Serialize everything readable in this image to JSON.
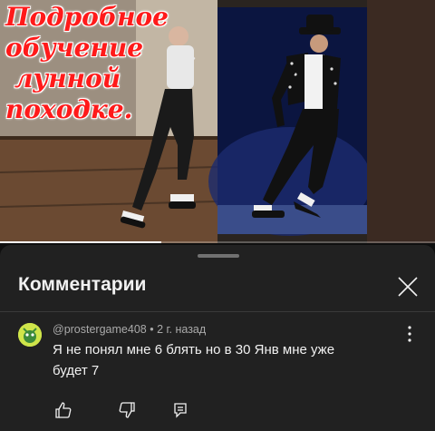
{
  "video": {
    "overlay_title_lines": [
      "Подробное",
      "обучение",
      "лунной",
      "походке."
    ],
    "progress_fraction": 0.37
  },
  "sheet": {
    "title": "Комментарии"
  },
  "comment": {
    "author": "@prostergame408",
    "separator": "•",
    "time": "2 г. назад",
    "text": "Я не понял мне 6 блять  но в 30 Янв мне уже будет 7"
  },
  "icons": {
    "close": "close-icon",
    "more": "more-vert-icon",
    "like": "thumb-up-icon",
    "dislike": "thumb-down-icon",
    "reply": "reply-icon"
  },
  "colors": {
    "background": "#0f0f0f",
    "sheet": "#212121",
    "title_red": "#ff1a1a",
    "meta_gray": "#aaaaaa"
  }
}
